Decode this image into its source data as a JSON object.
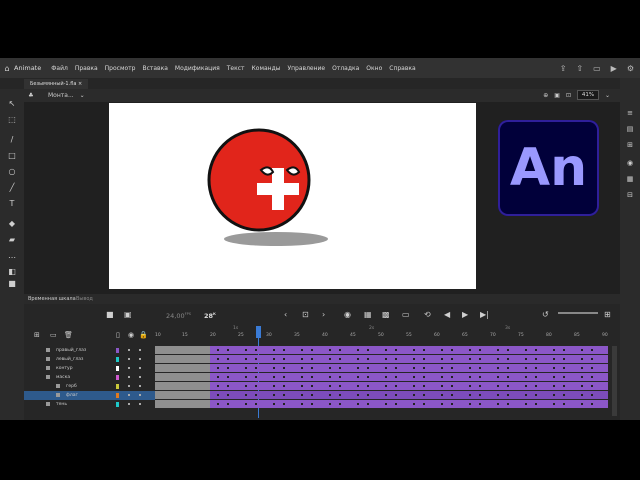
{
  "menubar": {
    "app_name": "Animate",
    "items": [
      "Файл",
      "Правка",
      "Просмотр",
      "Вставка",
      "Модификация",
      "Текст",
      "Команды",
      "Управление",
      "Отладка",
      "Окно",
      "Справка"
    ]
  },
  "document": {
    "tab_title": "Безымянный-1.fla"
  },
  "toolbar": {
    "scene_dropdown": "Монта...",
    "zoom": "41%"
  },
  "logo": {
    "text": "An",
    "bg": "#01003a",
    "fg": "#9a98ff"
  },
  "timeline": {
    "tabs": [
      "Временная шкала",
      "Вывод"
    ],
    "fps": "24,00",
    "fps_unit": "FPS",
    "current_frame": "28",
    "frame_unit": "К",
    "ruler_marks": [
      "10",
      "15",
      "20",
      "25",
      "30",
      "35",
      "40",
      "45",
      "50",
      "55",
      "60",
      "65",
      "70",
      "75",
      "80",
      "85",
      "90"
    ],
    "seconds_marks": [
      "1s",
      "2s",
      "3s"
    ],
    "layers": [
      {
        "name": "правый_глаз",
        "color": "#8b57c7"
      },
      {
        "name": "левый_глаз",
        "color": "#1ec8c8"
      },
      {
        "name": "контур",
        "color": "#ffffff"
      },
      {
        "name": "маска",
        "color": "#d05ad0"
      },
      {
        "name": "герб",
        "color": "#c8c83a"
      },
      {
        "name": "флаг",
        "color": "#e07a1e"
      },
      {
        "name": "тень",
        "color": "#1ec8c8"
      }
    ]
  },
  "colors": {
    "accent": "#3a7bd5",
    "frame_purple": "#8b57c7",
    "flag_red": "#e1251b"
  }
}
